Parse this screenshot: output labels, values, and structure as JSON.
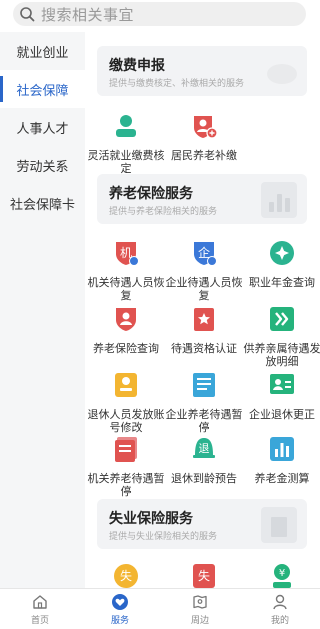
{
  "search": {
    "placeholder": "搜索相关事宜"
  },
  "sidebar": {
    "items": [
      {
        "label": "就业创业",
        "active": false
      },
      {
        "label": "社会保障",
        "active": true
      },
      {
        "label": "人事人才",
        "active": false
      },
      {
        "label": "劳动关系",
        "active": false
      },
      {
        "label": "社会保障卡",
        "active": false
      }
    ]
  },
  "sections": {
    "payment": {
      "title": "缴费申报",
      "subtitle": "提供与缴费核定、补缴相关的服务",
      "items": [
        {
          "label": "灵活就业缴费核定",
          "icon": "person-card-icon"
        },
        {
          "label": "居民养老补缴",
          "icon": "person-plus-icon"
        }
      ]
    },
    "pension": {
      "title": "养老保险服务",
      "subtitle": "提供与养老保险相关的服务",
      "items": [
        {
          "label": "机关待遇人员恢复",
          "icon": "ji-badge-icon"
        },
        {
          "label": "企业待遇人员恢复",
          "icon": "qi-badge-icon"
        },
        {
          "label": "职业年金查询",
          "icon": "diamond-circle-icon"
        },
        {
          "label": "养老保险查询",
          "icon": "person-shield-icon"
        },
        {
          "label": "待遇资格认证",
          "icon": "star-badge-icon"
        },
        {
          "label": "供养亲属待遇发放明细",
          "icon": "double-chevron-icon"
        },
        {
          "label": "退休人员发放账号修改",
          "icon": "account-card-icon"
        },
        {
          "label": "企业养老待遇暂停",
          "icon": "document-lines-icon"
        },
        {
          "label": "企业退休更正",
          "icon": "person-id-icon"
        },
        {
          "label": "机关养老待遇暂停",
          "icon": "document-stack-icon"
        },
        {
          "label": "退休到龄预告",
          "icon": "tui-bell-icon"
        },
        {
          "label": "养老金测算",
          "icon": "bar-chart-icon"
        }
      ]
    },
    "unemployment": {
      "title": "失业保险服务",
      "subtitle": "提供与失业保险相关的服务",
      "items": [
        {
          "label": "",
          "icon": "shi-coin-icon"
        },
        {
          "label": "",
          "icon": "shi-card-icon"
        },
        {
          "label": "",
          "icon": "yen-person-icon"
        }
      ]
    }
  },
  "bottom_nav": [
    {
      "label": "首页",
      "icon": "home-icon",
      "active": false
    },
    {
      "label": "服务",
      "icon": "heart-icon",
      "active": true
    },
    {
      "label": "周边",
      "icon": "map-pin-icon",
      "active": false
    },
    {
      "label": "我的",
      "icon": "user-icon",
      "active": false
    }
  ],
  "colors": {
    "accent": "#2a66c9",
    "teal": "#2bb390",
    "red": "#e05350",
    "blue": "#3b78d8",
    "yellow": "#f3b531",
    "sky": "#3aa6d9",
    "green": "#25b37c"
  },
  "glyphs": {
    "ji": "机",
    "qi": "企",
    "tui": "退",
    "shi": "失",
    "yen": "¥"
  }
}
